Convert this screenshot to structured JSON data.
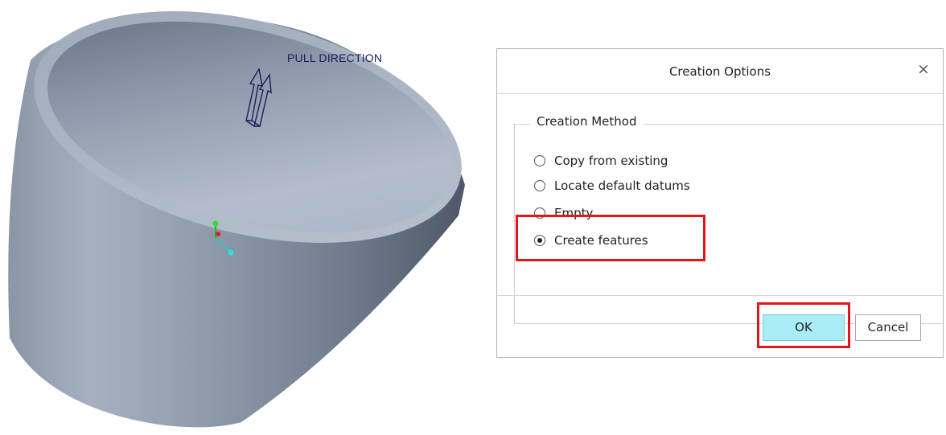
{
  "viewport": {
    "annotation": "PULL DIRECTION"
  },
  "dialog": {
    "title": "Creation Options",
    "close_symbol": "×",
    "group_label": "Creation Method",
    "options": [
      {
        "label": "Copy from existing",
        "selected": false
      },
      {
        "label": "Locate default datums",
        "selected": false
      },
      {
        "label": "Empty",
        "selected": false
      },
      {
        "label": "Create features",
        "selected": true
      }
    ],
    "ok_label": "OK",
    "cancel_label": "Cancel"
  },
  "colors": {
    "highlight": "#e8121a",
    "ok_button_bg": "#a9eef7",
    "part_surface": "#8f9bab"
  }
}
